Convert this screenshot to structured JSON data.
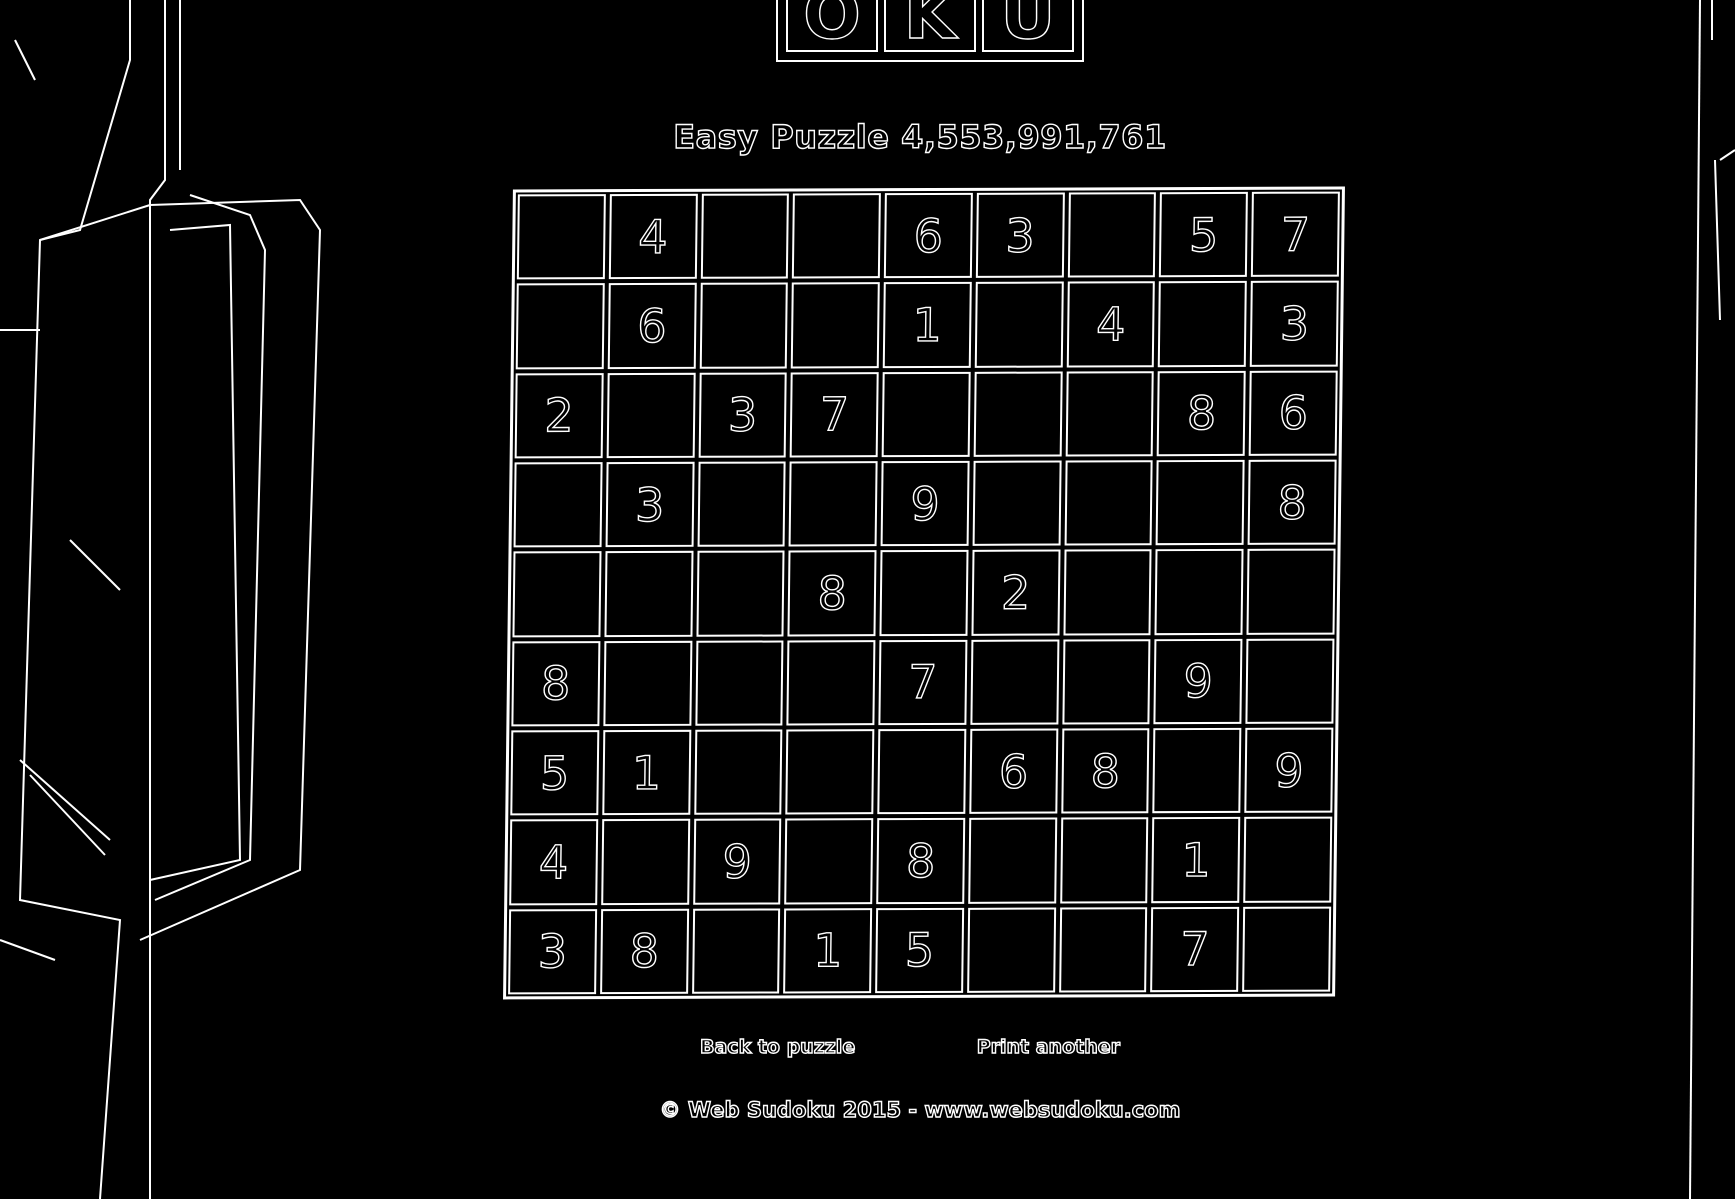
{
  "logo": {
    "letters": [
      "O",
      "K",
      "U"
    ]
  },
  "puzzle": {
    "title": "Easy Puzzle 4,553,991,761",
    "grid": [
      [
        "",
        "4",
        "",
        "",
        "6",
        "3",
        "",
        "5",
        "7"
      ],
      [
        "",
        "6",
        "",
        "",
        "1",
        "",
        "4",
        "",
        "3"
      ],
      [
        "2",
        "",
        "3",
        "7",
        "",
        "",
        "",
        "8",
        "6"
      ],
      [
        "",
        "3",
        "",
        "",
        "9",
        "",
        "",
        "",
        "8"
      ],
      [
        "",
        "",
        "",
        "8",
        "",
        "2",
        "",
        "",
        ""
      ],
      [
        "8",
        "",
        "",
        "",
        "7",
        "",
        "",
        "9",
        ""
      ],
      [
        "5",
        "1",
        "",
        "",
        "",
        "6",
        "8",
        "",
        "9"
      ],
      [
        "4",
        "",
        "9",
        "",
        "8",
        "",
        "",
        "1",
        ""
      ],
      [
        "3",
        "8",
        "",
        "1",
        "5",
        "",
        "",
        "7",
        ""
      ]
    ]
  },
  "links": {
    "back_to_puzzle": "Back to puzzle",
    "print_another": "Print another"
  },
  "footer": {
    "copyright": "© Web Sudoku 2015 - www.websudoku.com"
  }
}
